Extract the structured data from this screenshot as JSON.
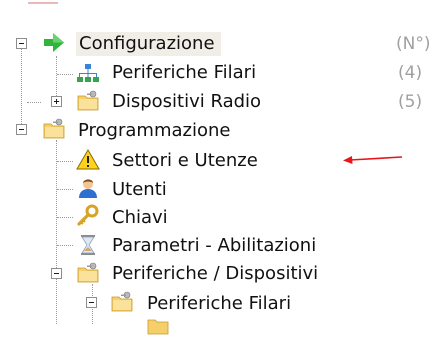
{
  "tree": {
    "configurazione": {
      "label": "Configurazione",
      "count": "(N°)"
    },
    "periferiche_filari_1": {
      "label": "Periferiche Filari",
      "count": "(4)"
    },
    "dispositivi_radio": {
      "label": "Dispositivi Radio",
      "count": "(5)"
    },
    "programmazione": {
      "label": "Programmazione"
    },
    "settori_utenze": {
      "label": "Settori e Utenze"
    },
    "utenti": {
      "label": "Utenti"
    },
    "chiavi": {
      "label": "Chiavi"
    },
    "parametri": {
      "label": "Parametri - Abilitazioni"
    },
    "periferiche_dispositivi": {
      "label": "Periferiche / Dispositivi"
    },
    "periferiche_filari_2": {
      "label": "Periferiche Filari"
    }
  },
  "colors": {
    "selection_bg": "#f1eee8",
    "count_gray": "#a0a0a0",
    "annotation_arrow": "#e8151b"
  },
  "icons": {
    "configurazione": "green-arrow-icon",
    "periferiche_filari": "network-icon",
    "folders": "folder-key-icon",
    "settori": "warning-icon",
    "utenti": "user-icon",
    "chiavi": "key-icon",
    "parametri": "hourglass-icon"
  }
}
